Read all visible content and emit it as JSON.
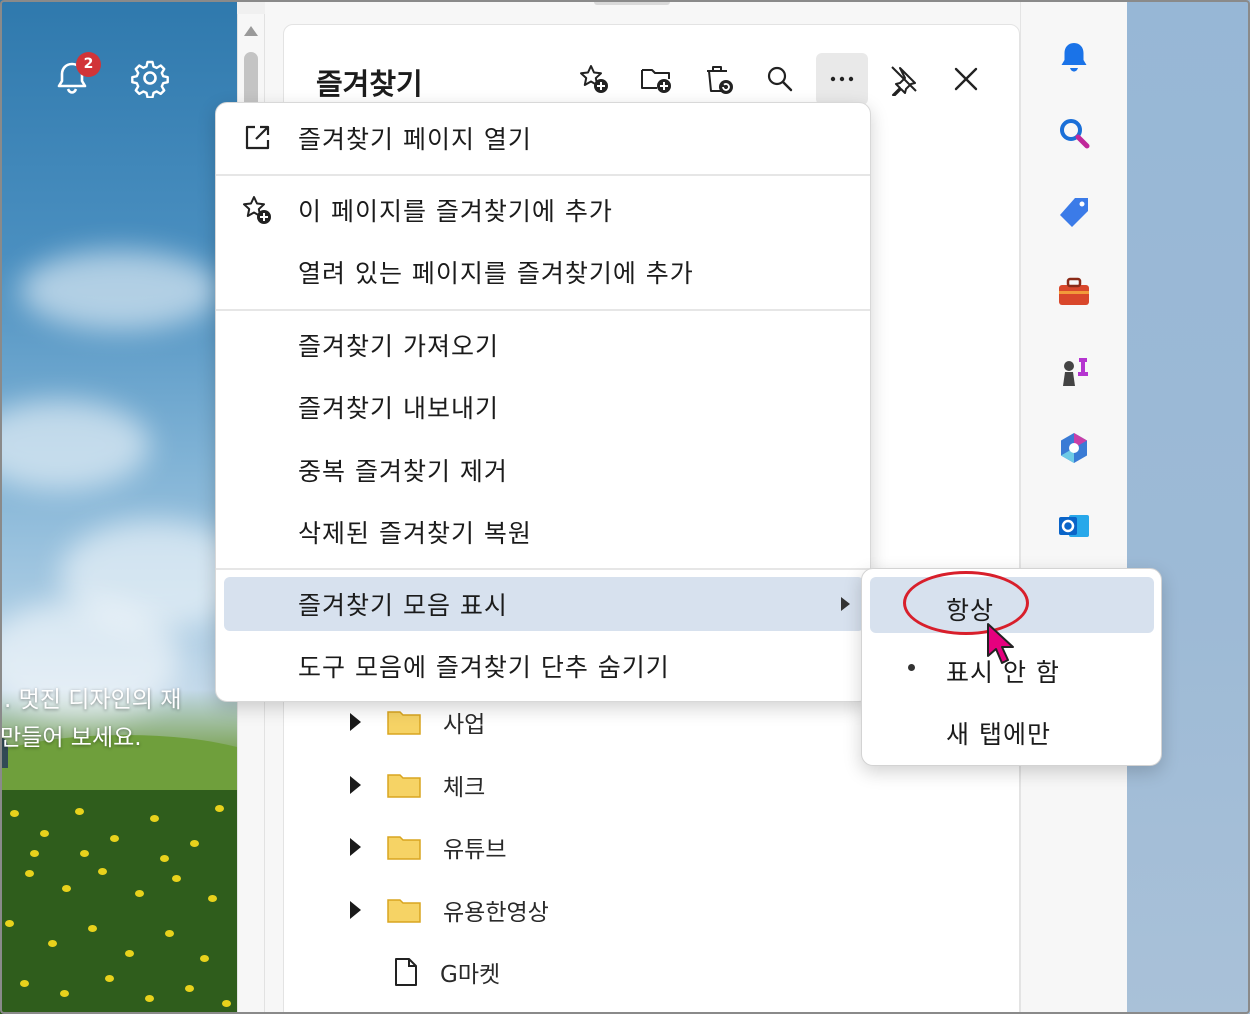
{
  "background": {
    "notification_count": "2",
    "promo_line_1": ". 멋진 디자인의 재",
    "promo_line_2": "만들어 보세요."
  },
  "favorites_panel": {
    "title": "즐겨찾기",
    "toolbar": [
      {
        "icon": "add-favorite-icon"
      },
      {
        "icon": "add-folder-icon"
      },
      {
        "icon": "recycle-icon"
      },
      {
        "icon": "search-icon"
      },
      {
        "icon": "more-options-icon"
      },
      {
        "icon": "unpin-icon"
      },
      {
        "icon": "close-icon"
      }
    ],
    "items": [
      {
        "type": "folder",
        "label": "사업"
      },
      {
        "type": "folder",
        "label": "체크"
      },
      {
        "type": "folder",
        "label": "유튜브"
      },
      {
        "type": "folder",
        "label": "유용한영상"
      },
      {
        "type": "page",
        "label": "G마켓"
      }
    ]
  },
  "context_menu": {
    "items": [
      {
        "label": "즐겨찾기 페이지 열기",
        "icon": "open-external-icon"
      },
      {
        "label": "이 페이지를 즐겨찾기에 추가",
        "icon": "add-favorite-icon"
      },
      {
        "label": "열려 있는 페이지를 즐겨찾기에 추가"
      },
      {
        "label": "즐겨찾기 가져오기"
      },
      {
        "label": "즐겨찾기 내보내기"
      },
      {
        "label": "중복 즐겨찾기 제거"
      },
      {
        "label": "삭제된 즐겨찾기 복원"
      },
      {
        "label": "즐겨찾기 모음 표시",
        "has_submenu": true,
        "highlighted": true
      },
      {
        "label": "도구 모음에 즐겨찾기 단추 숨기기"
      }
    ]
  },
  "submenu": {
    "items": [
      {
        "label": "항상",
        "highlighted": true,
        "selected": false
      },
      {
        "label": "표시 안 함",
        "selected": true
      },
      {
        "label": "새 탭에만",
        "selected": false
      }
    ]
  },
  "sidebar_icons": [
    "bell-icon",
    "search-icon",
    "shopping-tag-icon",
    "toolbox-icon",
    "games-icon",
    "copilot-icon",
    "outlook-icon"
  ],
  "colors": {
    "menu_highlight": "#d7e1ee",
    "annotation_red": "#d81f2b",
    "badge_red": "#d13438",
    "cursor_magenta": "#e6007e"
  }
}
